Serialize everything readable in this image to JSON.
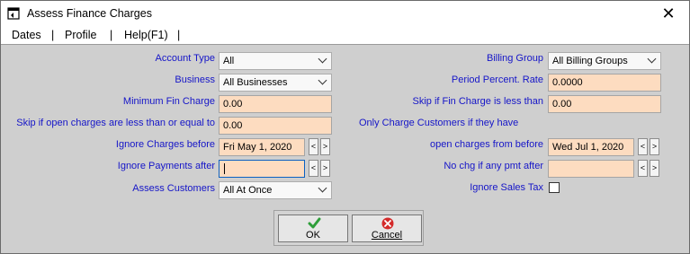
{
  "window": {
    "title": "Assess Finance Charges",
    "close_glyph": "✕"
  },
  "menu": {
    "items": [
      "Dates",
      "Profile",
      "Help(F1)"
    ],
    "separator": "|"
  },
  "left": {
    "account_type": {
      "label": "Account Type",
      "value": "All"
    },
    "business": {
      "label": "Business",
      "value": "All Businesses"
    },
    "min_fin_charge": {
      "label": "Minimum Fin Charge",
      "value": "0.00"
    },
    "skip_open_charges": {
      "label": "Skip if open charges are less than or equal to",
      "value": "0.00"
    },
    "ignore_charges_before": {
      "label": "Ignore Charges before",
      "value": "Fri May 1, 2020"
    },
    "ignore_payments_after": {
      "label": "Ignore Payments after",
      "value": ""
    },
    "assess_customers": {
      "label": "Assess Customers",
      "value": "All At Once"
    }
  },
  "right": {
    "billing_group": {
      "label": "Billing Group",
      "value": "All Billing Groups"
    },
    "period_rate": {
      "label": "Period Percent. Rate",
      "value": "0.0000"
    },
    "skip_fin_charge": {
      "label": "Skip if Fin Charge is less than",
      "value": "0.00"
    },
    "only_charge_note": {
      "label": "Only Charge Customers if they have"
    },
    "open_charges_from": {
      "label": "open charges from before",
      "value": "Wed Jul 1, 2020"
    },
    "no_chg_pmt_after": {
      "label": "No chg if any pmt after",
      "value": ""
    },
    "ignore_sales_tax": {
      "label": "Ignore Sales Tax",
      "checked": false
    }
  },
  "nav": {
    "prev": "<",
    "next": ">"
  },
  "buttons": {
    "ok": "OK",
    "cancel": "Cancel"
  },
  "colors": {
    "label_blue": "#1515c8",
    "input_bg": "#fddcc0",
    "panel_bg": "#cfcfcf",
    "ok_green": "#2e9e3a",
    "cancel_red": "#d42a2a"
  },
  "icons": {
    "app": "window-icon",
    "ok": "checkmark-icon",
    "cancel": "cancel-icon"
  }
}
